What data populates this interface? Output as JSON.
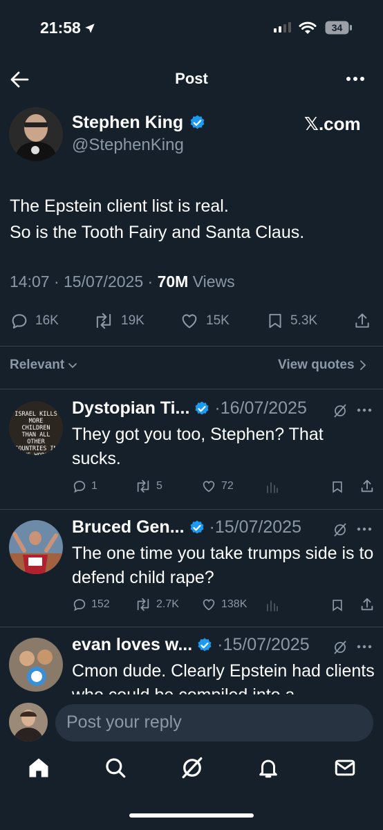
{
  "status_bar": {
    "time": "21:58",
    "battery": "34"
  },
  "header": {
    "title": "Post"
  },
  "post": {
    "author_name": "Stephen King",
    "author_handle": "@StephenKing",
    "source": "𝕏.com",
    "text_line1": "The Epstein client list is real.",
    "text_line2": "So is the Tooth Fairy and Santa Claus.",
    "timestamp": "14:07 · 15/07/2025 · ",
    "views_count": "70M",
    "views_label": " Views",
    "replies": "16K",
    "reposts": "19K",
    "likes": "15K",
    "bookmarks": "5.3K"
  },
  "filter": {
    "sort_label": "Relevant",
    "view_quotes": "View quotes"
  },
  "replies": [
    {
      "name": "Dystopian Ti...",
      "date": "·16/07/2025",
      "text": "They got you too, Stephen? That sucks.",
      "replies": "1",
      "reposts": "5",
      "likes": "72",
      "avatar_text": "ISRAEL KILLS MORE CHILDREN THAN ALL OTHER COUNTRIES IN THE WORLD COMBINED"
    },
    {
      "name": "Bruced Gen...",
      "date": "·15/07/2025",
      "text": "The one time you take trumps side is to defend child rape?",
      "replies": "152",
      "reposts": "2.7K",
      "likes": "138K"
    },
    {
      "name": "evan loves w...",
      "date": "·15/07/2025",
      "text": "Cmon dude. Clearly Epstein had clients who could be compiled into a",
      "replies": "",
      "reposts": "",
      "likes": ""
    }
  ],
  "composer": {
    "placeholder": "Post your reply"
  },
  "colors": {
    "background": "#15202b",
    "verified": "#1d9bf0",
    "secondary_text": "#8b98a5"
  }
}
